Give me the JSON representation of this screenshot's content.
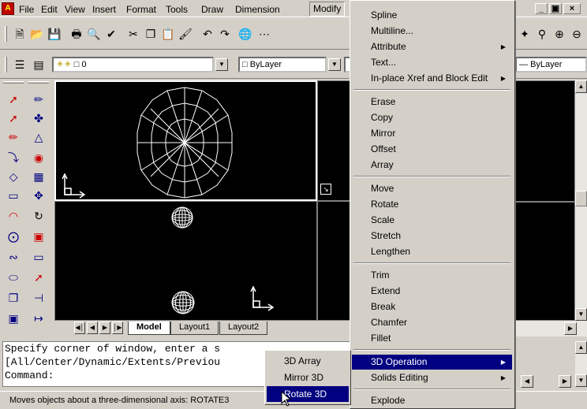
{
  "menubar": {
    "items": [
      "File",
      "Edit",
      "View",
      "Insert",
      "Format",
      "Tools",
      "Draw",
      "Dimension",
      "Modify"
    ]
  },
  "layer_toolbar": {
    "layer_value": "0",
    "color_value": "ByLayer",
    "lineweight_value": "ByLayer"
  },
  "tabs": {
    "model": "Model",
    "layout1": "Layout1",
    "layout2": "Layout2"
  },
  "command": {
    "line1": "Specify corner of window, enter a s",
    "line2": "[All/Center/Dynamic/Extents/Previou",
    "line3": "Command:"
  },
  "status": {
    "text": "Moves objects about a three-dimensional axis:  ROTATE3"
  },
  "modify_menu": {
    "items": [
      {
        "label": "Spline",
        "submenu": false
      },
      {
        "label": "Multiline...",
        "submenu": false
      },
      {
        "label": "Attribute",
        "submenu": true
      },
      {
        "label": "Text...",
        "submenu": false
      },
      {
        "label": "In-place Xref and Block Edit",
        "submenu": true
      },
      {
        "label": "Erase",
        "submenu": false
      },
      {
        "label": "Copy",
        "submenu": false
      },
      {
        "label": "Mirror",
        "submenu": false
      },
      {
        "label": "Offset",
        "submenu": false
      },
      {
        "label": "Array",
        "submenu": false
      },
      {
        "label": "Move",
        "submenu": false
      },
      {
        "label": "Rotate",
        "submenu": false
      },
      {
        "label": "Scale",
        "submenu": false
      },
      {
        "label": "Stretch",
        "submenu": false
      },
      {
        "label": "Lengthen",
        "submenu": false
      },
      {
        "label": "Trim",
        "submenu": false
      },
      {
        "label": "Extend",
        "submenu": false
      },
      {
        "label": "Break",
        "submenu": false
      },
      {
        "label": "Chamfer",
        "submenu": false
      },
      {
        "label": "Fillet",
        "submenu": false
      },
      {
        "label": "3D Operation",
        "submenu": true
      },
      {
        "label": "Solids Editing",
        "submenu": true
      },
      {
        "label": "Explode",
        "submenu": false
      }
    ]
  },
  "submenu_3d": {
    "items": [
      "3D Array",
      "Mirror 3D",
      "Rotate 3D"
    ]
  },
  "colors": {
    "highlight": "#000080",
    "face": "#d4d0c8",
    "viewport": "#000000"
  }
}
